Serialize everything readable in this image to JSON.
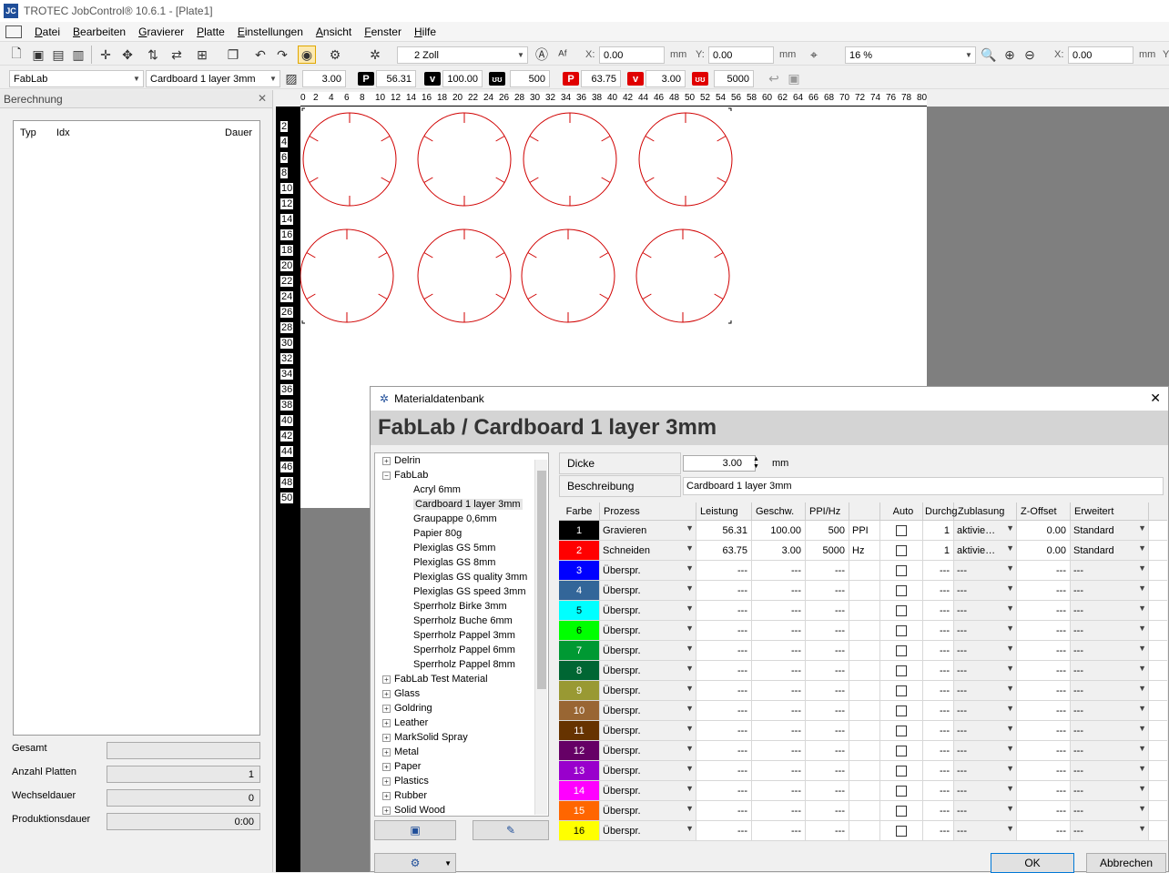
{
  "window": {
    "title": "TROTEC JobControl® 10.6.1 - [Plate1]",
    "app_icon": "JC"
  },
  "menu": [
    "Datei",
    "Bearbeiten",
    "Gravierer",
    "Platte",
    "Einstellungen",
    "Ansicht",
    "Fenster",
    "Hilfe"
  ],
  "toolbar": {
    "zoom_step": "2 Zoll",
    "x_label": "X:",
    "x_value": "0.00",
    "x_unit": "mm",
    "y_label": "Y:",
    "y_value": "0.00",
    "y_unit": "mm",
    "zoom": "16 %",
    "x2_label": "X:",
    "x2_value": "0.00",
    "x2_unit": "mm",
    "y2_label": "Y"
  },
  "materialbar": {
    "group": "FabLab",
    "material": "Cardboard 1 layer 3mm",
    "thickness": "3.00",
    "p_engrave": "56.31",
    "v_engrave": "100.00",
    "ppi": "500",
    "p_cut": "63.75",
    "v_cut": "3.00",
    "hz": "5000",
    "p_label": "P",
    "v_label": "v",
    "accent_engrave": "#000000",
    "accent_cut": "#e00000"
  },
  "left_panel": {
    "title": "Berechnung",
    "columns": [
      "Typ",
      "Idx",
      "Dauer"
    ],
    "stats": [
      {
        "label": "Gesamt",
        "value": ""
      },
      {
        "label": "Anzahl Platten",
        "value": "1"
      },
      {
        "label": "Wechseldauer",
        "value": "0"
      },
      {
        "label": "Produktionsdauer",
        "value": "0:00"
      }
    ]
  },
  "ruler": {
    "h": [
      "0",
      "2",
      "4",
      "6",
      "8",
      "10",
      "12",
      "14",
      "16",
      "18",
      "20",
      "22",
      "24",
      "26",
      "28",
      "30",
      "32",
      "34",
      "36",
      "38",
      "40",
      "42",
      "44",
      "46",
      "48",
      "50",
      "52",
      "54",
      "56",
      "58",
      "60",
      "62",
      "64",
      "66",
      "68",
      "70",
      "72",
      "74",
      "76",
      "78",
      "80"
    ],
    "v": [
      "2",
      "4",
      "6",
      "8",
      "10",
      "12",
      "14",
      "16",
      "18",
      "20",
      "22",
      "24",
      "26",
      "28",
      "30",
      "32",
      "34",
      "36",
      "38",
      "40",
      "42",
      "44",
      "46",
      "48",
      "50"
    ]
  },
  "dialog": {
    "title": "Materialdatenbank",
    "heading": "FabLab / Cardboard 1 layer 3mm",
    "close": "✕",
    "tree": [
      {
        "label": "Delrin",
        "level": 0,
        "sign": "+"
      },
      {
        "label": "FabLab",
        "level": 0,
        "sign": "−"
      },
      {
        "label": "Acryl 6mm",
        "level": 1
      },
      {
        "label": "Cardboard 1 layer 3mm",
        "level": 1,
        "selected": true
      },
      {
        "label": "Graupappe 0,6mm",
        "level": 1
      },
      {
        "label": "Papier 80g",
        "level": 1
      },
      {
        "label": "Plexiglas GS 5mm",
        "level": 1
      },
      {
        "label": "Plexiglas GS 8mm",
        "level": 1
      },
      {
        "label": "Plexiglas GS quality 3mm",
        "level": 1
      },
      {
        "label": "Plexiglas GS speed 3mm",
        "level": 1
      },
      {
        "label": "Sperrholz Birke 3mm",
        "level": 1
      },
      {
        "label": "Sperrholz Buche 6mm",
        "level": 1
      },
      {
        "label": "Sperrholz Pappel 3mm",
        "level": 1
      },
      {
        "label": "Sperrholz Pappel 6mm",
        "level": 1
      },
      {
        "label": "Sperrholz Pappel 8mm",
        "level": 1
      },
      {
        "label": "FabLab Test Material",
        "level": 0,
        "sign": "+"
      },
      {
        "label": "Glass",
        "level": 0,
        "sign": "+"
      },
      {
        "label": "Goldring",
        "level": 0,
        "sign": "+"
      },
      {
        "label": "Leather",
        "level": 0,
        "sign": "+"
      },
      {
        "label": "MarkSolid Spray",
        "level": 0,
        "sign": "+"
      },
      {
        "label": "Metal",
        "level": 0,
        "sign": "+"
      },
      {
        "label": "Paper",
        "level": 0,
        "sign": "+"
      },
      {
        "label": "Plastics",
        "level": 0,
        "sign": "+"
      },
      {
        "label": "Rubber",
        "level": 0,
        "sign": "+"
      },
      {
        "label": "Solid Wood",
        "level": 0,
        "sign": "+"
      }
    ],
    "dicke_label": "Dicke",
    "dicke_value": "3.00",
    "dicke_unit": "mm",
    "beschreibung_label": "Beschreibung",
    "beschreibung_value": "Cardboard 1 layer 3mm",
    "columns": [
      "Farbe",
      "Prozess",
      "Leistung",
      "Geschw.",
      "PPI/Hz",
      "",
      "Auto",
      "Durchg.",
      "Zublasung",
      "Z-Offset",
      "Erweitert"
    ],
    "rows": [
      {
        "n": "1",
        "color": "#000000",
        "process": "Gravieren",
        "power": "56.31",
        "speed": "100.00",
        "ppi": "500",
        "unit": "PPI",
        "passes": "1",
        "air": "aktivie…",
        "z": "0.00",
        "adv": "Standard"
      },
      {
        "n": "2",
        "color": "#ff0000",
        "process": "Schneiden",
        "power": "63.75",
        "speed": "3.00",
        "ppi": "5000",
        "unit": "Hz",
        "passes": "1",
        "air": "aktivie…",
        "z": "0.00",
        "adv": "Standard"
      },
      {
        "n": "3",
        "color": "#0000ff",
        "process": "Überspr.",
        "power": "---",
        "speed": "---",
        "ppi": "---",
        "unit": "",
        "passes": "---",
        "air": "---",
        "z": "---",
        "adv": "---"
      },
      {
        "n": "4",
        "color": "#336699",
        "process": "Überspr.",
        "power": "---",
        "speed": "---",
        "ppi": "---",
        "unit": "",
        "passes": "---",
        "air": "---",
        "z": "---",
        "adv": "---"
      },
      {
        "n": "5",
        "color": "#00ffff",
        "process": "Überspr.",
        "power": "---",
        "speed": "---",
        "ppi": "---",
        "unit": "",
        "passes": "---",
        "air": "---",
        "z": "---",
        "adv": "---"
      },
      {
        "n": "6",
        "color": "#00ff00",
        "process": "Überspr.",
        "power": "---",
        "speed": "---",
        "ppi": "---",
        "unit": "",
        "passes": "---",
        "air": "---",
        "z": "---",
        "adv": "---"
      },
      {
        "n": "7",
        "color": "#009933",
        "process": "Überspr.",
        "power": "---",
        "speed": "---",
        "ppi": "---",
        "unit": "",
        "passes": "---",
        "air": "---",
        "z": "---",
        "adv": "---"
      },
      {
        "n": "8",
        "color": "#006633",
        "process": "Überspr.",
        "power": "---",
        "speed": "---",
        "ppi": "---",
        "unit": "",
        "passes": "---",
        "air": "---",
        "z": "---",
        "adv": "---"
      },
      {
        "n": "9",
        "color": "#999933",
        "process": "Überspr.",
        "power": "---",
        "speed": "---",
        "ppi": "---",
        "unit": "",
        "passes": "---",
        "air": "---",
        "z": "---",
        "adv": "---"
      },
      {
        "n": "10",
        "color": "#996633",
        "process": "Überspr.",
        "power": "---",
        "speed": "---",
        "ppi": "---",
        "unit": "",
        "passes": "---",
        "air": "---",
        "z": "---",
        "adv": "---"
      },
      {
        "n": "11",
        "color": "#663300",
        "process": "Überspr.",
        "power": "---",
        "speed": "---",
        "ppi": "---",
        "unit": "",
        "passes": "---",
        "air": "---",
        "z": "---",
        "adv": "---"
      },
      {
        "n": "12",
        "color": "#660066",
        "process": "Überspr.",
        "power": "---",
        "speed": "---",
        "ppi": "---",
        "unit": "",
        "passes": "---",
        "air": "---",
        "z": "---",
        "adv": "---"
      },
      {
        "n": "13",
        "color": "#9900cc",
        "process": "Überspr.",
        "power": "---",
        "speed": "---",
        "ppi": "---",
        "unit": "",
        "passes": "---",
        "air": "---",
        "z": "---",
        "adv": "---"
      },
      {
        "n": "14",
        "color": "#ff00ff",
        "process": "Überspr.",
        "power": "---",
        "speed": "---",
        "ppi": "---",
        "unit": "",
        "passes": "---",
        "air": "---",
        "z": "---",
        "adv": "---"
      },
      {
        "n": "15",
        "color": "#ff6600",
        "process": "Überspr.",
        "power": "---",
        "speed": "---",
        "ppi": "---",
        "unit": "",
        "passes": "---",
        "air": "---",
        "z": "---",
        "adv": "---"
      },
      {
        "n": "16",
        "color": "#ffff00",
        "process": "Überspr.",
        "power": "---",
        "speed": "---",
        "ppi": "---",
        "unit": "",
        "passes": "---",
        "air": "---",
        "z": "---",
        "adv": "---"
      }
    ],
    "ok": "OK",
    "cancel": "Abbrechen"
  }
}
